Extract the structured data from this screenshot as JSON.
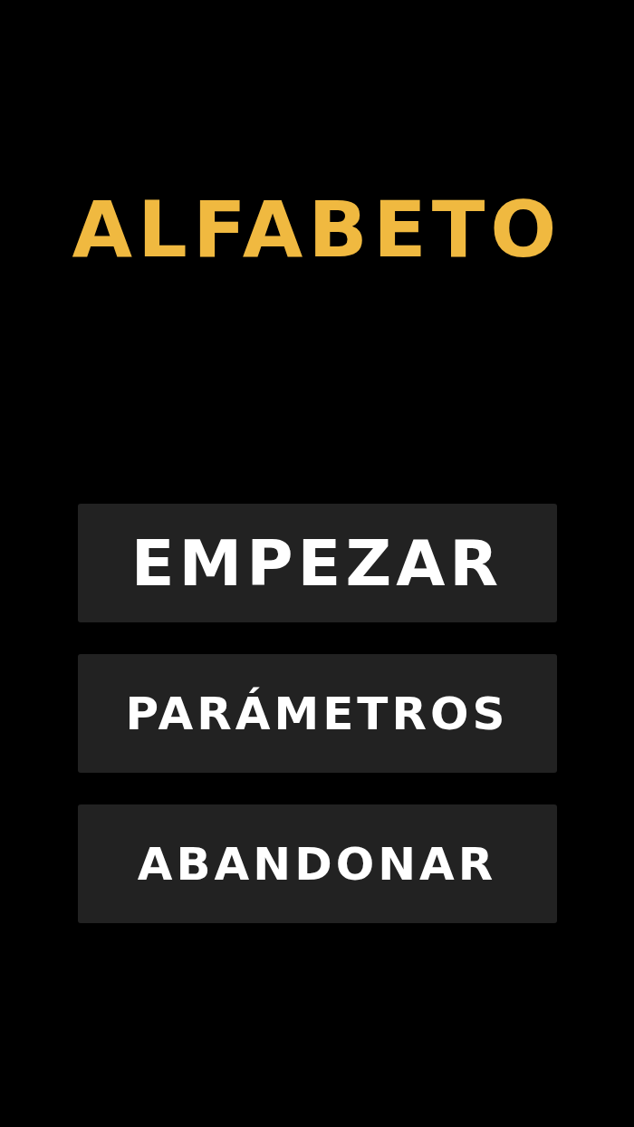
{
  "title": "ALFABETO",
  "menu": [
    {
      "label": "EMPEZAR",
      "kind": "primary"
    },
    {
      "label": "PARÁMETROS",
      "kind": "secondary"
    },
    {
      "label": "ABANDONAR",
      "kind": "secondary"
    }
  ]
}
